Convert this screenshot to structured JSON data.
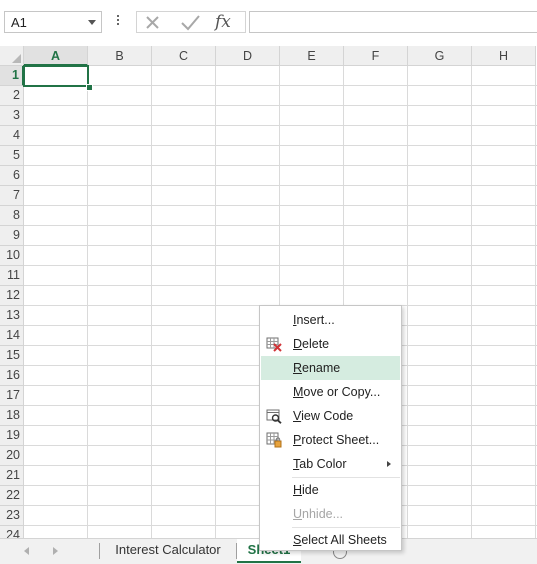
{
  "name_box": {
    "value": "A1"
  },
  "formula_bar": {
    "fx_label": "fx",
    "value": ""
  },
  "active_cell": "A1",
  "columns": [
    "A",
    "B",
    "C",
    "D",
    "E",
    "F",
    "G",
    "H"
  ],
  "rows": [
    "1",
    "2",
    "3",
    "4",
    "5",
    "6",
    "7",
    "8",
    "9",
    "10",
    "11",
    "12",
    "13",
    "14",
    "15",
    "16",
    "17",
    "18",
    "19",
    "20",
    "21",
    "22",
    "23",
    "24"
  ],
  "sheet_tabs": [
    {
      "label": "Interest Calculator",
      "active": false
    },
    {
      "label": "Sheet1",
      "active": true
    }
  ],
  "context_menu": {
    "items": [
      {
        "label": "Insert...",
        "icon": "none",
        "enabled": true
      },
      {
        "label": "Delete",
        "icon": "delete-sheet-icon",
        "enabled": true
      },
      {
        "label": "Rename",
        "icon": "none",
        "enabled": true,
        "highlighted": true
      },
      {
        "label": "Move or Copy...",
        "icon": "none",
        "enabled": true
      },
      {
        "label": "View Code",
        "icon": "view-code-icon",
        "enabled": true
      },
      {
        "label": "Protect Sheet...",
        "icon": "protect-sheet-icon",
        "enabled": true
      },
      {
        "label": "Tab Color",
        "icon": "none",
        "enabled": true,
        "submenu": true
      },
      {
        "label": "Hide",
        "icon": "none",
        "enabled": true
      },
      {
        "label": "Unhide...",
        "icon": "none",
        "enabled": false
      },
      {
        "label": "Select All Sheets",
        "icon": "none",
        "enabled": true
      }
    ]
  },
  "colors": {
    "accent": "#217346",
    "highlight": "#d5ece0",
    "delete_red": "#d13438"
  }
}
